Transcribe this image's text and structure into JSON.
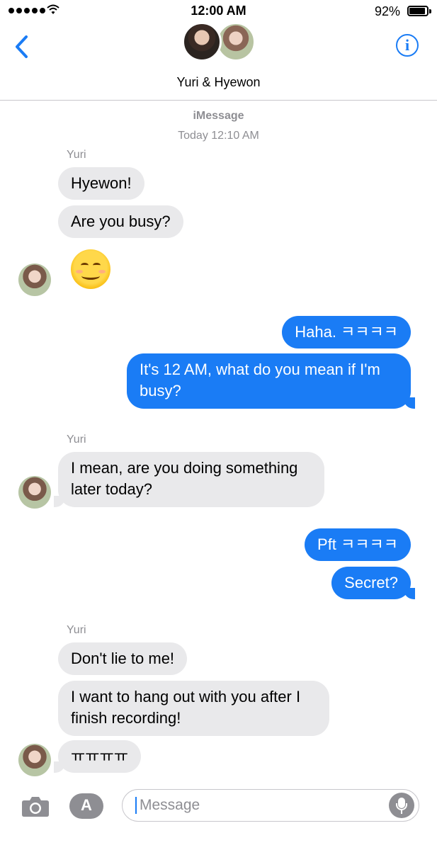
{
  "status_bar": {
    "time": "12:00 AM",
    "battery": "92%",
    "battery_level": 0.92
  },
  "header": {
    "title": "Yuri & Hyewon",
    "info_symbol": "i"
  },
  "thread": {
    "service": "iMessage",
    "timestamp": "Today 12:10 AM",
    "sender_labels": [
      "Yuri",
      "Yuri",
      "Yuri"
    ],
    "incoming": [
      "Hyewon!",
      "Are you busy?",
      "I mean, are you doing something later today?",
      "Don't lie to me!",
      "I want to hang out with you after I finish recording!",
      "ㅠㅠㅠㅠ"
    ],
    "outgoing": [
      "Haha. ㅋㅋㅋㅋ",
      "It's 12 AM, what do you mean if I'm busy?",
      "Pft ㅋㅋㅋㅋ",
      "Secret?"
    ],
    "emoji": "smiling-face-emoji"
  },
  "composer": {
    "placeholder": "Message",
    "app_symbol": "A"
  },
  "colors": {
    "accent": "#1a7cf5",
    "incoming_bubble": "#e9e9eb",
    "outgoing_bubble": "#1a7cf5",
    "secondary_text": "#8e8e93"
  }
}
